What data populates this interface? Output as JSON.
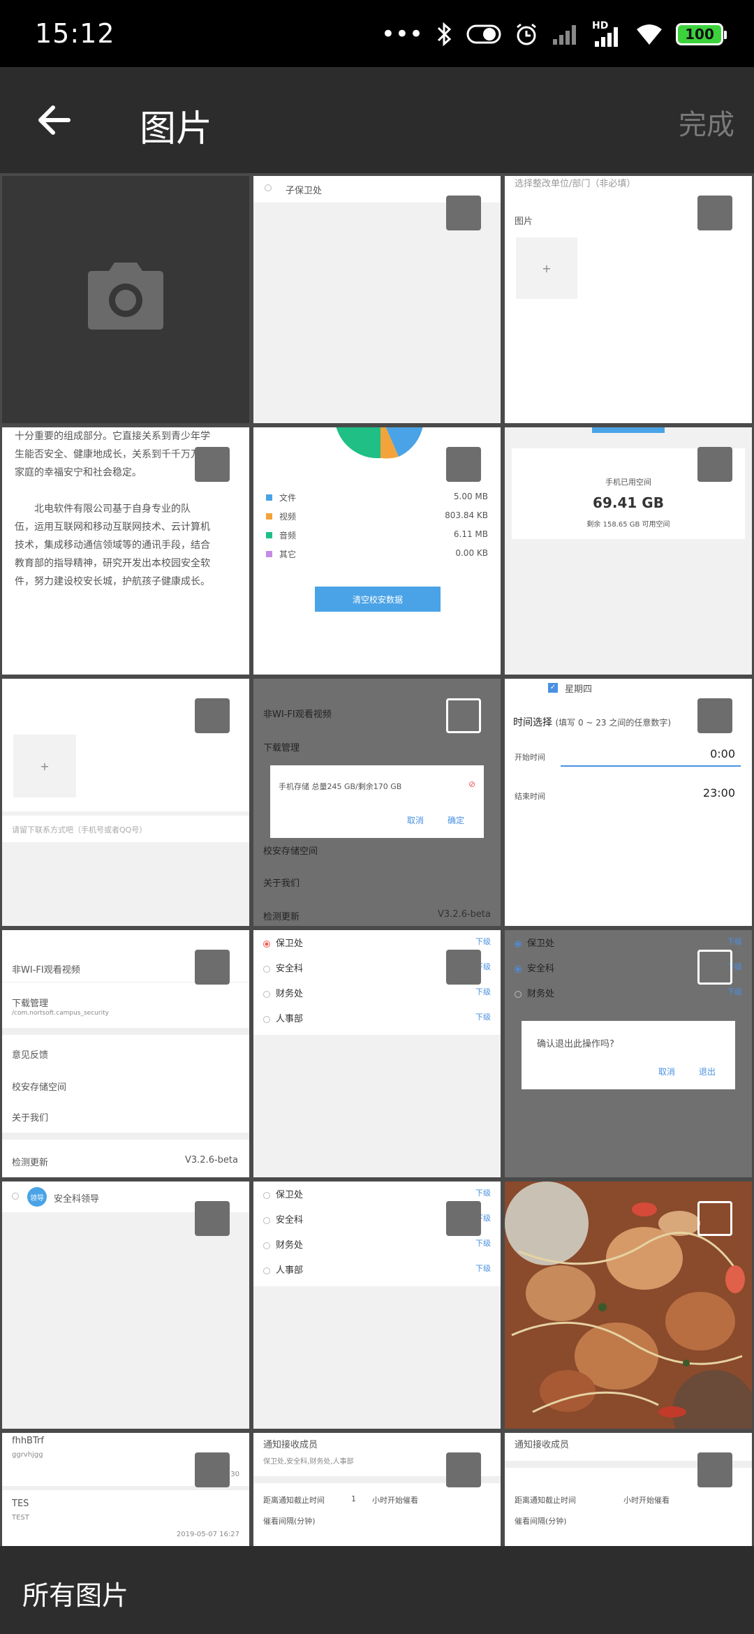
{
  "statusbar": {
    "time": "15:12",
    "battery": "100",
    "hd": "HD"
  },
  "appbar": {
    "title": "图片",
    "done": "完成"
  },
  "bottombar": {
    "label": "所有图片"
  },
  "cells": {
    "c2": {
      "item": "子保卫处"
    },
    "c3": {
      "unit_hint": "选择整改单位/部门（非必填）",
      "pic_label": "图片",
      "plus": "+"
    },
    "c4": {
      "lines": [
        "十分重要的组成部分。它直接关系到青少年学",
        "生能否安全、健康地成长，关系到千千万万个",
        "家庭的幸福安宁和社会稳定。",
        "",
        "北电软件有限公司基于自身专业的队",
        "伍，运用互联网和移动互联网技术、云计算机",
        "技术，集成移动通信领域等的通讯手段，结合",
        "教育部的指导精神，研究开发出本校园安全软",
        "件，努力建设校安长城，护航孩子健康成长。"
      ]
    },
    "c5": {
      "legend": [
        {
          "name": "文件",
          "size": "5.00 MB",
          "color": "#4aa3e6"
        },
        {
          "name": "视频",
          "size": "803.84 KB",
          "color": "#f2a33a"
        },
        {
          "name": "音频",
          "size": "6.11 MB",
          "color": "#1fbf86"
        },
        {
          "name": "其它",
          "size": "0.00 KB",
          "color": "#c58be6"
        }
      ],
      "clear_btn": "清空校安数据"
    },
    "c6": {
      "used_label": "手机已用空间",
      "used": "69.41 GB",
      "remain": "剩余 158.65 GB 可用空间"
    },
    "c7": {
      "plus": "+",
      "contact_hint": "请留下联系方式吧（手机号或者QQ号）"
    },
    "c8": {
      "wifi": "非WI-FI观看视频",
      "download": "下载管理",
      "dialog_text": "手机存储  总量245 GB/剩余170 GB",
      "cancel": "取消",
      "ok": "确定",
      "storage": "校安存储空间",
      "about": "关于我们",
      "update": "检测更新",
      "version": "V3.2.6-beta"
    },
    "c9": {
      "weekday": "星期四",
      "time_select": "时间选择",
      "time_hint": "(填写 0 ~ 23 之间的任意数字)",
      "start": "开始时间",
      "start_val": "0:00",
      "end": "结束时间",
      "end_val": "23:00"
    },
    "c10": {
      "wifi": "非WI-FI观看视频",
      "download": "下载管理",
      "path": "/com.nortsoft.campus_security",
      "feedback": "意见反馈",
      "storage": "校安存储空间",
      "about": "关于我们",
      "update": "检测更新",
      "version": "V3.2.6-beta"
    },
    "c11": {
      "items": [
        "保卫处",
        "安全科",
        "财务处",
        "人事部"
      ],
      "sub": "下级"
    },
    "c12": {
      "items": [
        "保卫处",
        "安全科",
        "财务处"
      ],
      "sub": "下级",
      "dialog": "确认退出此操作吗?",
      "cancel": "取消",
      "exit": "退出"
    },
    "c13": {
      "tag": "领导",
      "name": "安全科领导"
    },
    "c14": {
      "items": [
        "保卫处",
        "安全科",
        "财务处",
        "人事部"
      ],
      "sub": "下级"
    },
    "c16": {
      "t1": "fhhBTrf",
      "s1": "ggrvhjgg",
      "d1": "201 30",
      "t2": "TES",
      "s2": "TEST",
      "d2": "2019-05-07 16:27"
    },
    "c17": {
      "label": "通知接收成员",
      "members": "保卫处,安全科,财务处,人事部",
      "cutoff": "距离通知截止时间",
      "num": "1",
      "after": "小时开始催看",
      "interval": "催看间隔(分钟)"
    },
    "c18": {
      "label": "通知接收成员",
      "cutoff": "距离通知截止时间",
      "after": "小时开始催看",
      "interval": "催看间隔(分钟)"
    }
  }
}
